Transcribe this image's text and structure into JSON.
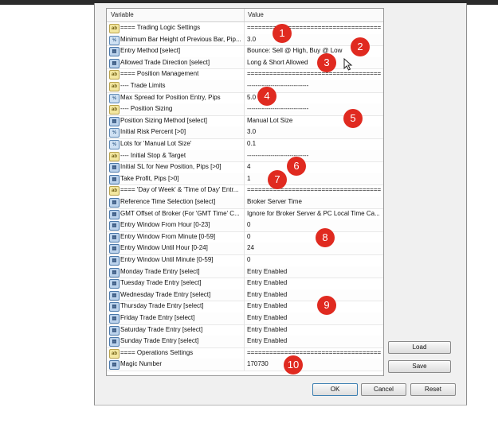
{
  "grid": {
    "col_variable": "Variable",
    "col_value": "Value",
    "rows": [
      {
        "icon": "ab",
        "name": "==== Trading Logic Settings",
        "value": "=========================================="
      },
      {
        "icon": "num",
        "name": "Minimum Bar Height of Previous Bar, Pip...",
        "value": "3.0"
      },
      {
        "icon": "sel",
        "name": "Entry Method [select]",
        "value": "Bounce: Sell @ High, Buy @ Low"
      },
      {
        "icon": "sel",
        "name": "Allowed Trade Direction [select]",
        "value": "Long & Short Allowed"
      },
      {
        "icon": "ab",
        "name": "==== Position Management",
        "value": "=========================================="
      },
      {
        "icon": "ab",
        "name": "---- Trade Limits",
        "value": "-----------------------------"
      },
      {
        "icon": "num",
        "name": "Max Spread for Position Entry, Pips",
        "value": "5.0"
      },
      {
        "icon": "ab",
        "name": "---- Position Sizing",
        "value": "-----------------------------"
      },
      {
        "icon": "sel",
        "name": "Position Sizing Method [select]",
        "value": "Manual Lot Size"
      },
      {
        "icon": "num",
        "name": "Initial Risk Percent [>0]",
        "value": "3.0"
      },
      {
        "icon": "num",
        "name": "Lots for 'Manual Lot Size'",
        "value": "0.1"
      },
      {
        "icon": "ab",
        "name": "---- Initial Stop & Target",
        "value": "-----------------------------"
      },
      {
        "icon": "sel",
        "name": "Initial SL for New Position, Pips [>0]",
        "value": "4"
      },
      {
        "icon": "sel",
        "name": "Take Profit, Pips [>0]",
        "value": "1"
      },
      {
        "icon": "ab",
        "name": "==== 'Day of Week' & 'Time of Day' Entr...",
        "value": "=========================================="
      },
      {
        "icon": "sel",
        "name": "Reference Time Selection [select]",
        "value": "Broker Server Time"
      },
      {
        "icon": "sel",
        "name": "GMT Offset of Broker (For 'GMT Time' C...",
        "value": "Ignore for Broker Server & PC Local Time Ca..."
      },
      {
        "icon": "sel",
        "name": "Entry Window From Hour [0-23]",
        "value": "0"
      },
      {
        "icon": "sel",
        "name": "Entry Window From Minute [0-59]",
        "value": "0"
      },
      {
        "icon": "sel",
        "name": "Entry Window Until Hour [0-24]",
        "value": "24"
      },
      {
        "icon": "sel",
        "name": "Entry Window Until Minute [0-59]",
        "value": "0"
      },
      {
        "icon": "sel",
        "name": "Monday Trade Entry [select]",
        "value": "Entry Enabled"
      },
      {
        "icon": "sel",
        "name": "Tuesday Trade Entry [select]",
        "value": "Entry Enabled"
      },
      {
        "icon": "sel",
        "name": "Wednesday Trade Entry [select]",
        "value": "Entry Enabled"
      },
      {
        "icon": "sel",
        "name": "Thursday Trade Entry [select]",
        "value": "Entry Enabled"
      },
      {
        "icon": "sel",
        "name": "Friday Trade Entry [select]",
        "value": "Entry Enabled"
      },
      {
        "icon": "sel",
        "name": "Saturday Trade Entry [select]",
        "value": "Entry Enabled"
      },
      {
        "icon": "sel",
        "name": "Sunday Trade Entry [select]",
        "value": "Entry Enabled"
      },
      {
        "icon": "ab",
        "name": "==== Operations Settings",
        "value": "=========================================="
      },
      {
        "icon": "sel",
        "name": "Magic Number",
        "value": "170730"
      }
    ]
  },
  "badges": [
    "1",
    "2",
    "3",
    "4",
    "5",
    "6",
    "7",
    "8",
    "9",
    "10"
  ],
  "buttons": {
    "load": "Load",
    "save": "Save",
    "ok": "OK",
    "cancel": "Cancel",
    "reset": "Reset"
  }
}
